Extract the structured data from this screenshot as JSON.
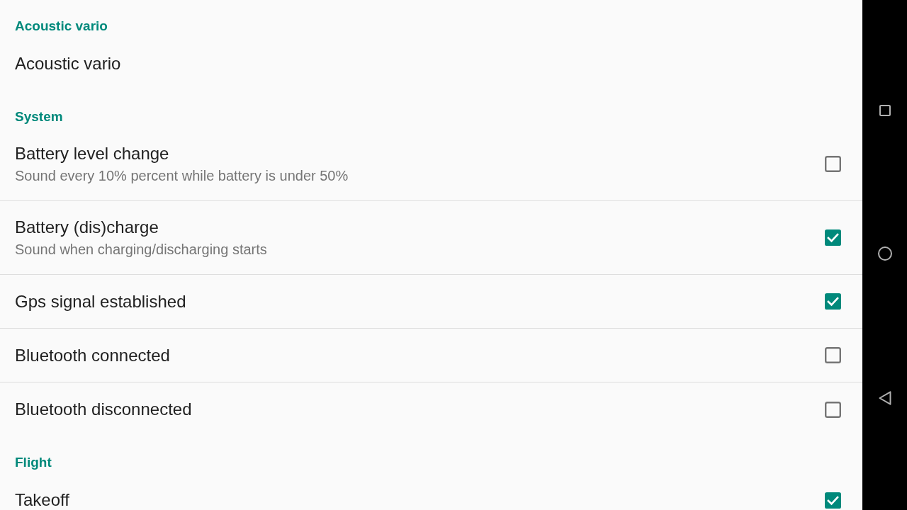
{
  "categories": [
    {
      "title": "Acoustic vario",
      "items": [
        {
          "kind": "plain",
          "title": "Acoustic vario"
        }
      ]
    },
    {
      "title": "System",
      "items": [
        {
          "kind": "checkbox",
          "title": "Battery level change",
          "summary": "Sound every 10% percent while battery is under 50%",
          "checked": false
        },
        {
          "kind": "checkbox",
          "title": "Battery (dis)charge",
          "summary": "Sound when charging/discharging starts",
          "checked": true
        },
        {
          "kind": "checkbox",
          "title": "Gps signal established",
          "checked": true
        },
        {
          "kind": "checkbox",
          "title": "Bluetooth connected",
          "checked": false
        },
        {
          "kind": "checkbox",
          "title": "Bluetooth disconnected",
          "checked": false
        }
      ]
    },
    {
      "title": "Flight",
      "items": [
        {
          "kind": "checkbox",
          "title": "Takeoff",
          "checked": true
        }
      ]
    }
  ]
}
